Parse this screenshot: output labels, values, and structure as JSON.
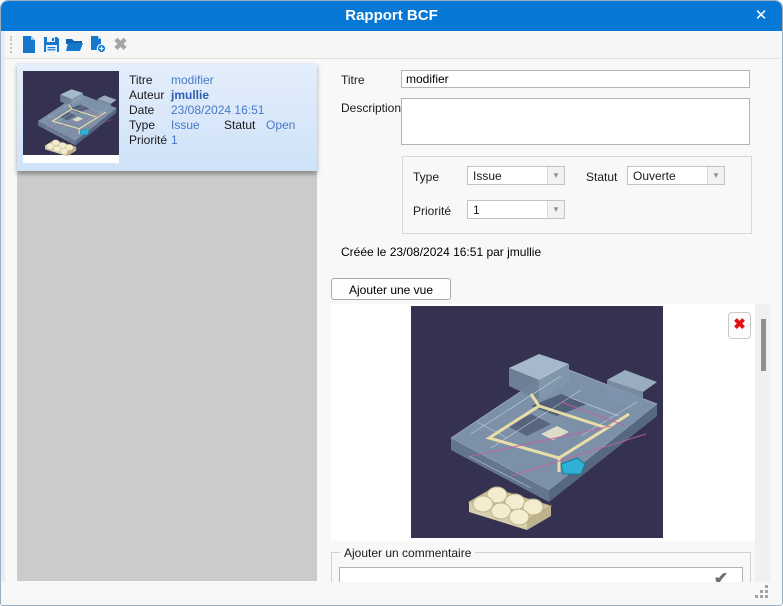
{
  "titlebar": {
    "title": "Rapport BCF",
    "close_icon": "✕"
  },
  "toolbar": {
    "icon_names": [
      "new-document",
      "save",
      "open-folder",
      "add-document",
      "delete"
    ],
    "delete_icon": "✖"
  },
  "list_item": {
    "titre_label": "Titre",
    "titre": "modifier",
    "auteur_label": "Auteur",
    "auteur": "jmullie",
    "date_label": "Date",
    "date": "23/08/2024 16:51",
    "type_label": "Type",
    "type": "Issue",
    "statut_label": "Statut",
    "statut": "Open",
    "priorite_label": "Priorité",
    "priorite": "1"
  },
  "form": {
    "titre_label": "Titre",
    "titre_value": "modifier",
    "description_label": "Description",
    "description_value": "",
    "type_label": "Type",
    "type_value": "Issue",
    "statut_label": "Statut",
    "statut_value": "Ouverte",
    "priorite_label": "Priorité",
    "priorite_value": "1",
    "dropdown_arrow": "▾",
    "created_text": "Créée le 23/08/2024 16:51 par jmullie",
    "add_view_button": "Ajouter une vue"
  },
  "viewer": {
    "delete_view_icon": "✖"
  },
  "comment": {
    "legend": "Ajouter un commentaire",
    "value": "",
    "submit_icon": "✔"
  },
  "colors": {
    "titlebar_blue": "#0878d6",
    "accent_blue": "#4979c9",
    "selected_item_bg": "#d7e6f9",
    "list_bg": "#cbcbcb",
    "viewer_image_bg": "#343250",
    "delete_red": "#e01010"
  }
}
